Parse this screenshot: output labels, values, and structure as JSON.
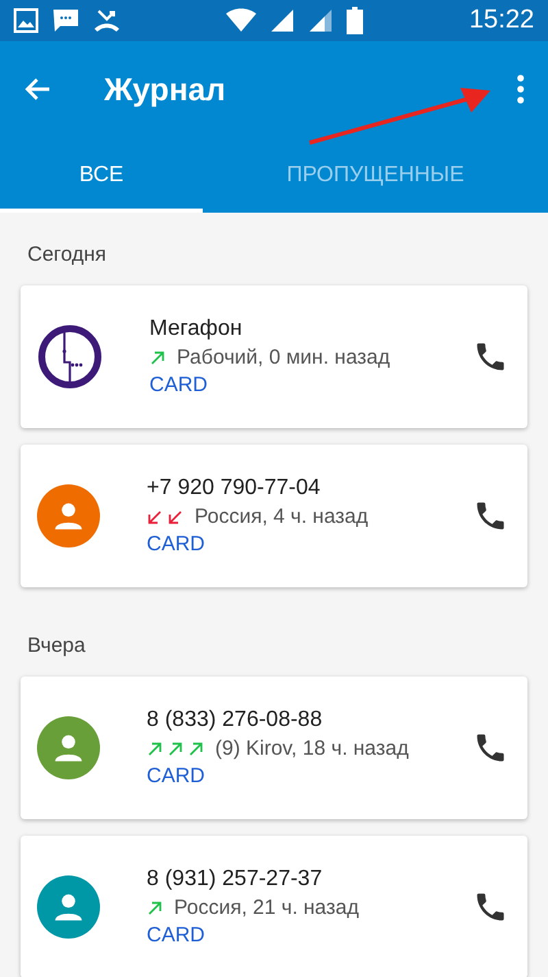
{
  "status_bar": {
    "time": "15:22"
  },
  "toolbar": {
    "title": "Журнал"
  },
  "tabs": [
    {
      "label": "ВСЕ",
      "selected": true
    },
    {
      "label": "ПРОПУЩЕННЫЕ",
      "selected": false
    }
  ],
  "sections": [
    {
      "title": "Сегодня",
      "calls": [
        {
          "avatar": {
            "kind": "logo",
            "color": "#3d1a78"
          },
          "name": "Мегафон",
          "arrows": [
            {
              "kind": "outgoing"
            }
          ],
          "detail": "Рабочий, 0 мин. назад",
          "action": "CARD"
        },
        {
          "avatar": {
            "kind": "person",
            "color": "#ef6c00"
          },
          "name": "+7 920 790-77-04",
          "arrows": [
            {
              "kind": "missed"
            },
            {
              "kind": "missed"
            }
          ],
          "detail": "Россия, 4 ч. назад",
          "action": "CARD"
        }
      ]
    },
    {
      "title": "Вчера",
      "calls": [
        {
          "avatar": {
            "kind": "person",
            "color": "#689f38"
          },
          "name": "8 (833) 276-08-88",
          "arrows": [
            {
              "kind": "outgoing"
            },
            {
              "kind": "outgoing"
            },
            {
              "kind": "outgoing"
            }
          ],
          "detail": "(9) Kirov, 18 ч. назад",
          "action": "CARD"
        },
        {
          "avatar": {
            "kind": "person",
            "color": "#0097a7"
          },
          "name": "8 (931) 257-27-37",
          "arrows": [
            {
              "kind": "outgoing"
            }
          ],
          "detail": "Россия, 21 ч. назад",
          "action": "CARD"
        }
      ]
    }
  ]
}
